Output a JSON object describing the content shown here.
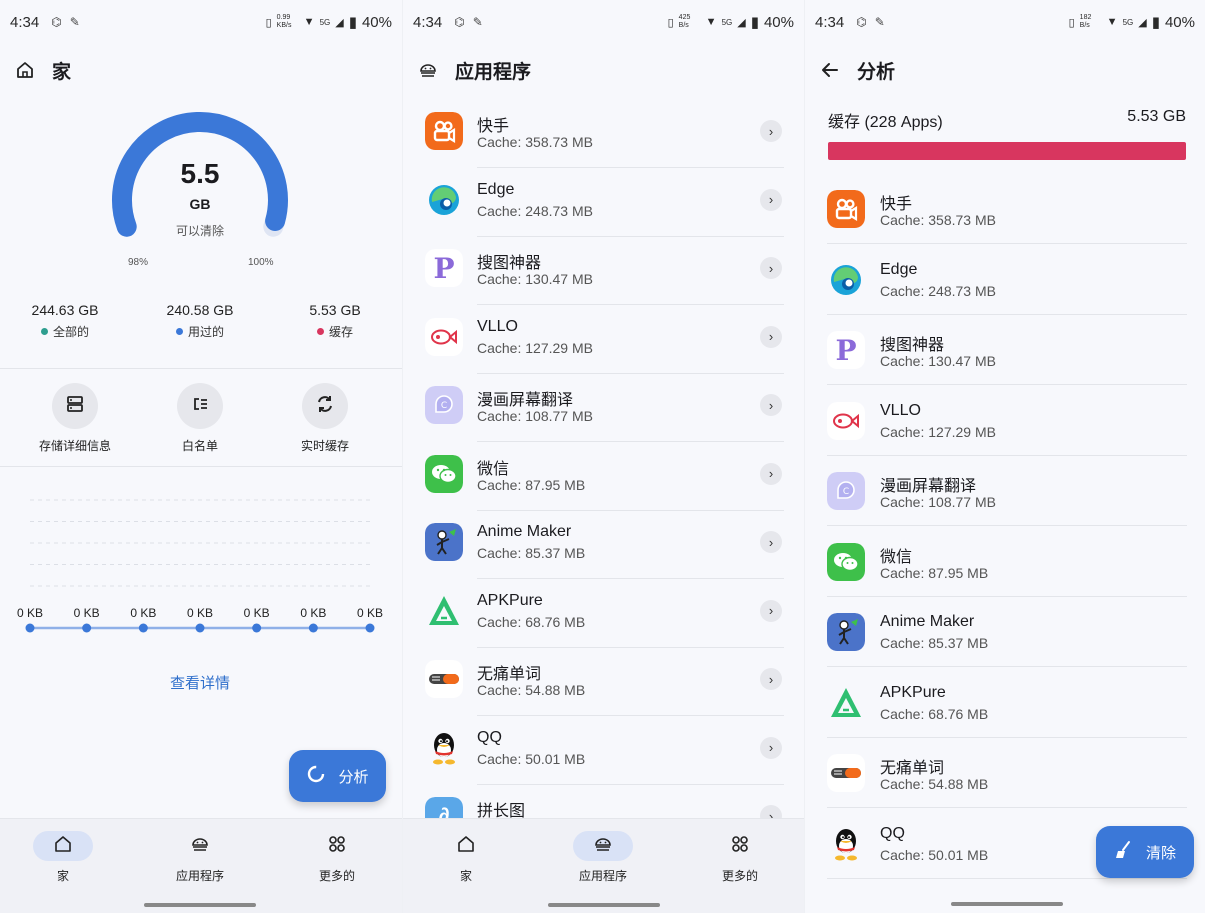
{
  "status_bars": [
    {
      "time": "4:34",
      "speed": "0.99 KB/s",
      "net": "5G",
      "battery": "40%"
    },
    {
      "time": "4:34",
      "speed": "425 B/s",
      "net": "5G",
      "battery": "40%"
    },
    {
      "time": "4:34",
      "speed": "182 B/s",
      "net": "5G",
      "battery": "40%"
    }
  ],
  "home": {
    "title": "家",
    "gauge": {
      "value": "5.5",
      "unit": "GB",
      "label": "可以清除",
      "left_pct": "98%",
      "right_pct": "100%",
      "fill_fraction": 0.98
    },
    "stats": [
      {
        "value": "244.63 GB",
        "label": "全部的",
        "color": "#2e9e8f"
      },
      {
        "value": "240.58 GB",
        "label": "用过的",
        "color": "#3b78d8"
      },
      {
        "value": "5.53 GB",
        "label": "缓存",
        "color": "#d8365f"
      }
    ],
    "tools": [
      {
        "label": "存储详细信息",
        "icon": "storage-icon"
      },
      {
        "label": "白名单",
        "icon": "whitelist-icon"
      },
      {
        "label": "实时缓存",
        "icon": "sync-icon"
      }
    ],
    "chart_data": {
      "type": "line",
      "x": [
        1,
        2,
        3,
        4,
        5,
        6,
        7
      ],
      "values": [
        0,
        0,
        0,
        0,
        0,
        0,
        0
      ],
      "data_labels": [
        "0 KB",
        "0 KB",
        "0 KB",
        "0 KB",
        "0 KB",
        "0 KB",
        "0 KB"
      ],
      "grid": true
    },
    "details_link": "查看详情",
    "fab_label": "分析"
  },
  "nav": {
    "home": "家",
    "apps": "应用程序",
    "more": "更多的"
  },
  "apps_screen": {
    "title": "应用程序",
    "items": [
      {
        "name": "快手",
        "cache": "Cache: 358.73 MB",
        "icon": "kuaishou-icon"
      },
      {
        "name": "Edge",
        "cache": "Cache: 248.73 MB",
        "icon": "edge-icon"
      },
      {
        "name": "搜图神器",
        "cache": "Cache: 130.47 MB",
        "icon": "soutu-icon"
      },
      {
        "name": "VLLO",
        "cache": "Cache: 127.29 MB",
        "icon": "vllo-icon"
      },
      {
        "name": "漫画屏幕翻译",
        "cache": "Cache: 108.77 MB",
        "icon": "manga-translate-icon"
      },
      {
        "name": "微信",
        "cache": "Cache: 87.95 MB",
        "icon": "wechat-icon"
      },
      {
        "name": "Anime Maker",
        "cache": "Cache: 85.37 MB",
        "icon": "anime-maker-icon"
      },
      {
        "name": "APKPure",
        "cache": "Cache: 68.76 MB",
        "icon": "apkpure-icon"
      },
      {
        "name": "无痛单词",
        "cache": "Cache: 54.88 MB",
        "icon": "wutong-icon"
      },
      {
        "name": "QQ",
        "cache": "Cache: 50.01 MB",
        "icon": "qq-icon"
      },
      {
        "name": "拼长图",
        "cache": "",
        "icon": "pinchangtu-icon"
      }
    ]
  },
  "analysis": {
    "title": "分析",
    "cache_label": "缓存 (228 Apps)",
    "cache_total": "5.53 GB",
    "bar_color": "#d8365f",
    "fab_label": "清除"
  }
}
